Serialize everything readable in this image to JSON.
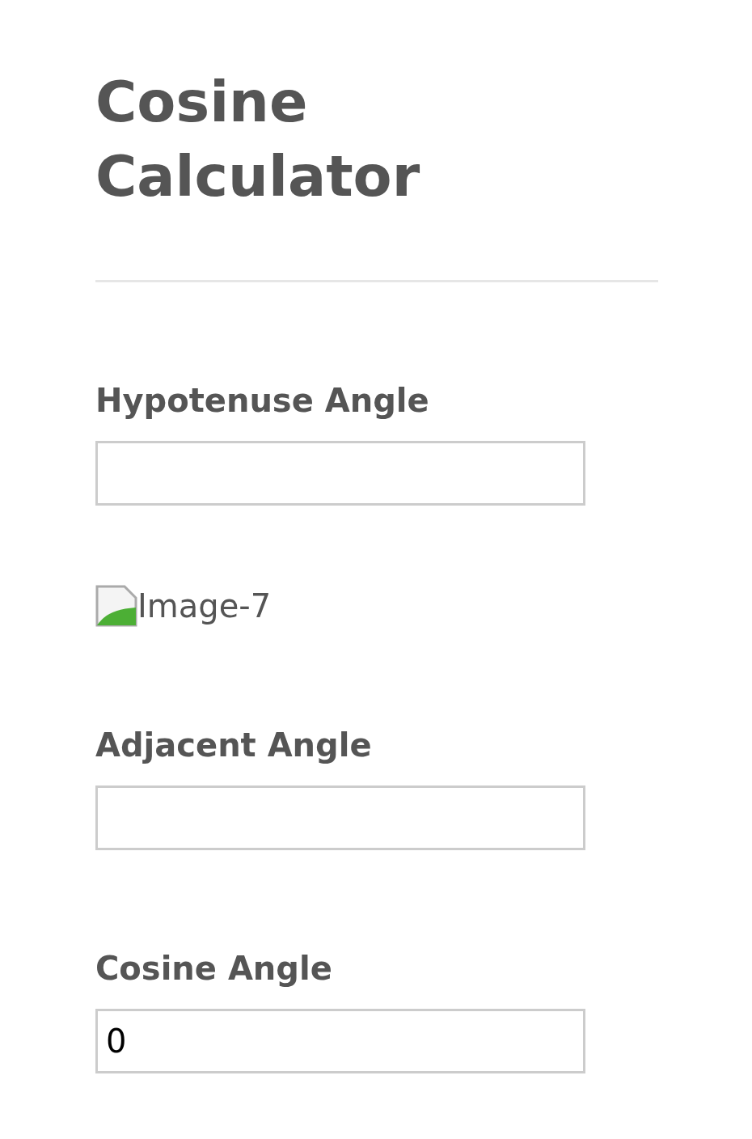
{
  "title": "Cosine Calculator",
  "items": [
    {
      "kind": "field",
      "label": "Hypotenuse Angle",
      "value": ""
    },
    {
      "kind": "image",
      "alt": "Image-7"
    },
    {
      "kind": "field",
      "label": "Adjacent Angle",
      "value": ""
    },
    {
      "kind": "field",
      "label": "Cosine Angle",
      "value": "0"
    }
  ]
}
